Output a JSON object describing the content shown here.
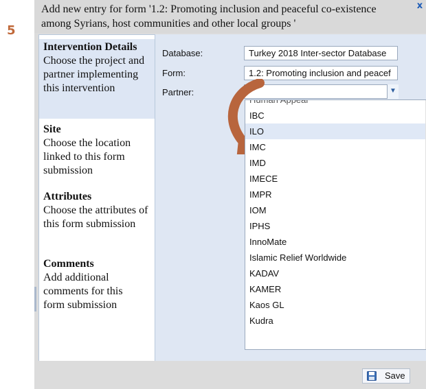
{
  "step_number": "5",
  "dialog": {
    "title": "Add new entry for form '1.2: Promoting inclusion and peaceful co-existence among Syrians, host communities and other local groups '",
    "close_symbol": "x"
  },
  "nav": {
    "items": [
      {
        "title": "Intervention Details",
        "description": "Choose the project and partner implementing this intervention",
        "active": true
      },
      {
        "title": "Site",
        "description": "Choose the location linked to this form submission",
        "active": false
      },
      {
        "title": "Attributes",
        "description": "Choose the attributes of this form submission",
        "active": false
      },
      {
        "title": "Comments",
        "description": "Add additional comments for this form submission",
        "active": false
      }
    ]
  },
  "form": {
    "database_label": "Database:",
    "database_value": "Turkey 2018 Inter-sector Database",
    "form_label": "Form:",
    "form_value": "1.2: Promoting inclusion and peacef",
    "partner_label": "Partner:",
    "partner_value": ""
  },
  "dropdown": {
    "partial_top": "Human Appeal",
    "options": [
      "IBC",
      "ILO",
      "IMC",
      "IMD",
      "IMECE",
      "IMPR",
      "IOM",
      "IPHS",
      "InnoMate",
      "Islamic Relief Worldwide",
      "KADAV",
      "KAMER",
      "Kaos GL",
      "Kudra"
    ],
    "highlighted": "ILO"
  },
  "footer": {
    "save_label": "Save"
  },
  "colors": {
    "accent": "#c0693a",
    "panel": "#dfe7f3",
    "highlight": "#dfe8f6"
  },
  "icons": {
    "close": "close-icon",
    "combo": "chevron-down-icon",
    "save": "floppy-disk-icon",
    "pointer": "curved-arrow-icon"
  }
}
